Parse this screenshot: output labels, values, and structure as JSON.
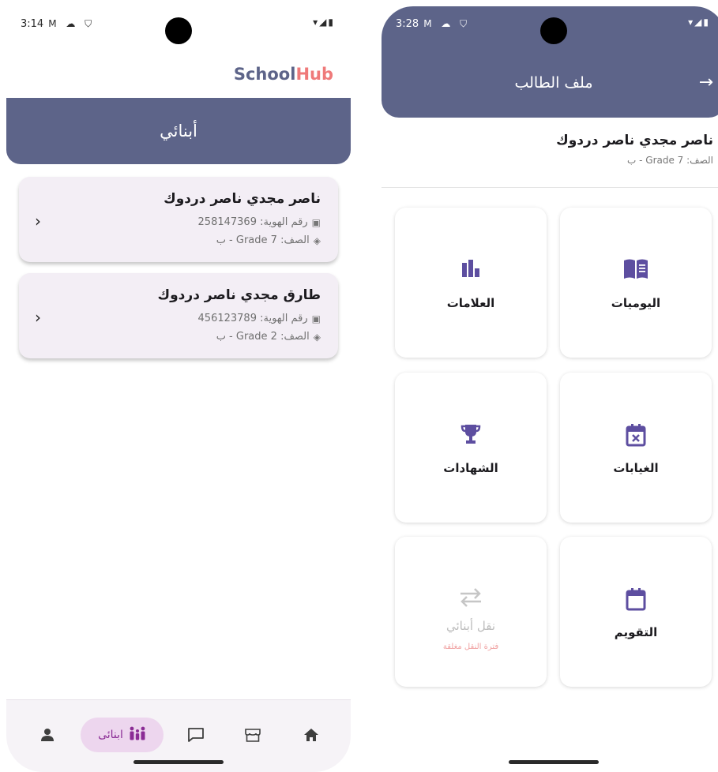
{
  "left_screen": {
    "status": {
      "time": "3:14",
      "icons": "M ☁ ⛉",
      "right_icons": "▾◢▮"
    },
    "brand": {
      "part1": "School",
      "part2": "Hub"
    },
    "header_title": "أبنائي",
    "children": [
      {
        "name": "ناصر مجدي ناصر دردوك",
        "id_label": "رقم الهوية: 258147369",
        "grade_label": "الصف: Grade 7 - ب"
      },
      {
        "name": "طارق مجدي ناصر دردوك",
        "id_label": "رقم الهوية: 456123789",
        "grade_label": "الصف: Grade 2 - ب"
      }
    ],
    "bottom_nav": {
      "active_label": "ابنائى"
    }
  },
  "right_screen": {
    "status": {
      "time": "3:28",
      "icons": "M ☁ ⛉",
      "right_icons": "▾◢▮"
    },
    "header_title": "ملف الطالب",
    "student": {
      "name": "ناصر مجدي ناصر دردوك",
      "grade": "الصف: Grade 7 - ب"
    },
    "tiles": [
      {
        "label": "اليوميات",
        "icon": "book-icon"
      },
      {
        "label": "العلامات",
        "icon": "bar-chart-icon"
      },
      {
        "label": "الغيابات",
        "icon": "calendar-x-icon"
      },
      {
        "label": "الشهادات",
        "icon": "trophy-icon"
      },
      {
        "label": "التقويم",
        "icon": "calendar-icon"
      },
      {
        "label": "نقل أبنائي",
        "icon": "swap-icon",
        "sub": "فترة النقل مغلقة",
        "disabled": true
      }
    ]
  },
  "colors": {
    "primary": "#5d6489",
    "accent": "#ef7a7a",
    "icon": "#5d4ea0",
    "nav_active": "#8b2c95"
  }
}
